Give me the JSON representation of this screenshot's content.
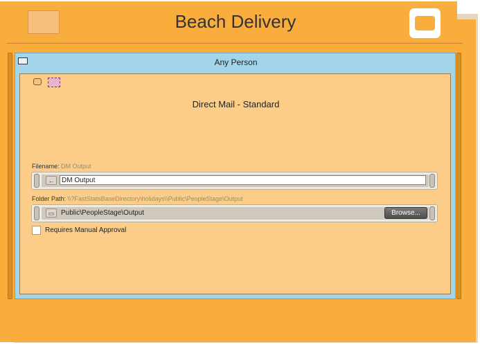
{
  "header": {
    "title": "Beach Delivery"
  },
  "panel": {
    "title": "Any Person"
  },
  "card": {
    "title": "Direct Mail - Standard",
    "filename": {
      "label": "Filename:",
      "hint": "DM Output",
      "value": "DM Output"
    },
    "folder": {
      "label": "Folder Path:",
      "hint": "\\\\?FastStatsBaseDirectory\\holidays\\\\Public\\PeopleStage\\Output",
      "value": "Public\\PeopleStage\\Output",
      "browse_label": "Browse..."
    },
    "manual_approval": {
      "label": "Requires Manual Approval",
      "checked": false
    }
  },
  "colors": {
    "card_orange": "#f9ad3d",
    "panel_blue": "#a2d4ea",
    "inner_peach": "#fbcd88"
  }
}
